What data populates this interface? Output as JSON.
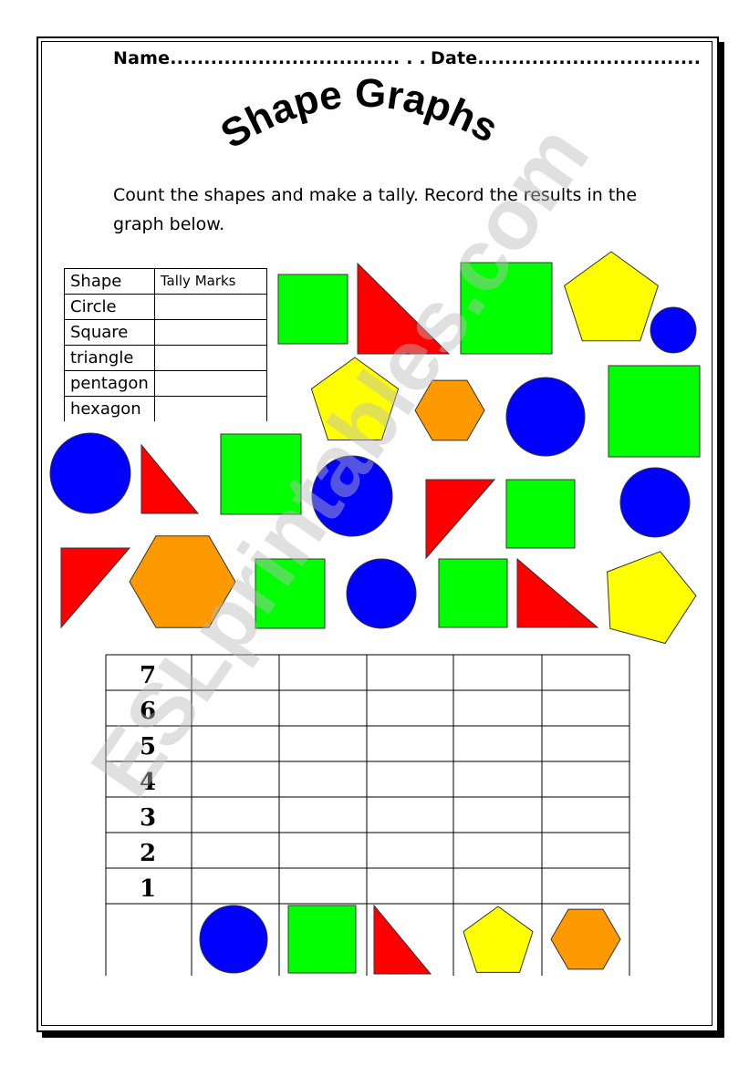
{
  "header": {
    "name_label": "Name.................................. . .",
    "date_label": "Date................................."
  },
  "title": "Shape Graphs",
  "instructions": "Count the shapes and make a tally. Record the results in the graph below.",
  "tally_table": {
    "headers": [
      "Shape",
      "Tally Marks"
    ],
    "rows": [
      "Circle",
      "Square",
      "triangle",
      "pentagon",
      "hexagon"
    ]
  },
  "graph": {
    "y_labels": [
      "7",
      "6",
      "5",
      "4",
      "3",
      "2",
      "1"
    ],
    "columns": [
      "circle",
      "square",
      "triangle",
      "pentagon",
      "hexagon"
    ]
  },
  "colors": {
    "circle": "#0000ff",
    "square": "#00ff00",
    "triangle": "#ff0000",
    "pentagon": "#ffff00",
    "hexagon": "#ff9900"
  },
  "watermark": "ESLprintables.com"
}
